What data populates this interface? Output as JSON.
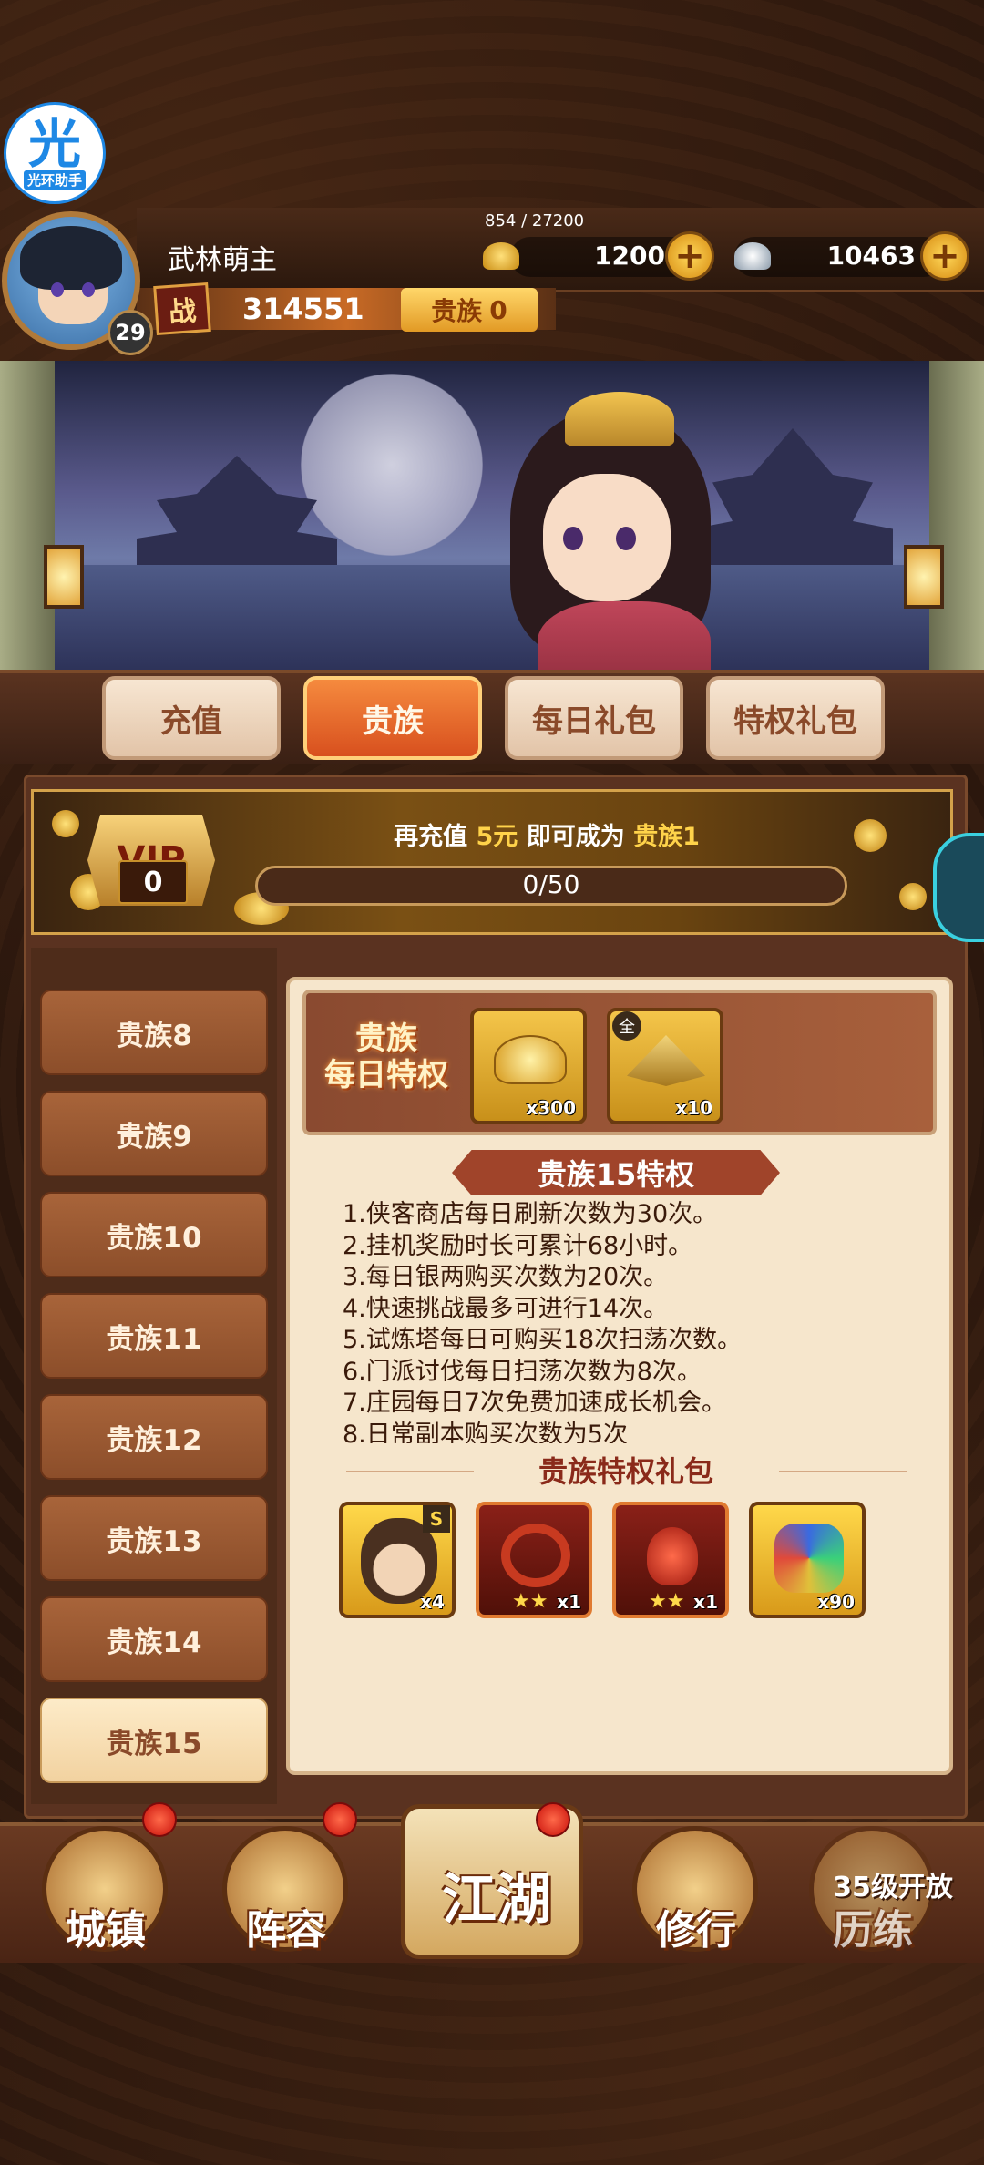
{
  "helper": {
    "glyph": "光",
    "label": "光环助手"
  },
  "player": {
    "name": "武林萌主",
    "level": "29",
    "exp_text": "854 / 27200",
    "power_label": "战",
    "power": "314551",
    "noble_label": "贵族",
    "noble_level": "0"
  },
  "currency": {
    "gold": "1200",
    "silver": "10463",
    "plus": "+"
  },
  "tabs": [
    {
      "label": "充值",
      "active": false
    },
    {
      "label": "贵族",
      "active": true
    },
    {
      "label": "每日礼包",
      "active": false
    },
    {
      "label": "特权礼包",
      "active": false
    }
  ],
  "vip": {
    "badge": "VIP",
    "level": "0",
    "msg_prefix": "再充值",
    "msg_amount": "5元",
    "msg_mid": "即可成为",
    "msg_target": "贵族1",
    "progress_text": "0/50",
    "progress_value": 0
  },
  "sidebar": {
    "items": [
      {
        "label": "贵族8",
        "active": false
      },
      {
        "label": "贵族9",
        "active": false
      },
      {
        "label": "贵族10",
        "active": false
      },
      {
        "label": "贵族11",
        "active": false
      },
      {
        "label": "贵族12",
        "active": false
      },
      {
        "label": "贵族13",
        "active": false
      },
      {
        "label": "贵族14",
        "active": false
      },
      {
        "label": "贵族15",
        "active": true
      }
    ]
  },
  "daily": {
    "title_line1": "贵族",
    "title_line2": "每日特权",
    "items": [
      {
        "icon": "gold-ingot-icon",
        "qty": "x300"
      },
      {
        "icon": "bamboo-hat-icon",
        "badge": "全",
        "qty": "x10"
      }
    ]
  },
  "privilege": {
    "title": "贵族15特权",
    "lines": [
      "1.侠客商店每日刷新次数为30次。",
      "2.挂机奖励时长可累计68小时。",
      "3.每日银两购买次数为20次。",
      "4.快速挑战最多可进行14次。",
      "5.试炼塔每日可购买18次扫荡次数。",
      "6.门派讨伐每日扫荡次数为8次。",
      "7.庄园每日7次免费加速成长机会。",
      "8.日常副本购买次数为5次"
    ]
  },
  "gift": {
    "title": "贵族特权礼包",
    "items": [
      {
        "icon": "hero-portrait-icon",
        "badge": "S",
        "qty": "x4"
      },
      {
        "icon": "red-ring-icon",
        "stars": "★★",
        "qty": "x1"
      },
      {
        "icon": "red-ornament-icon",
        "stars": "★★",
        "qty": "x1"
      },
      {
        "icon": "gem-cluster-icon",
        "qty": "x90"
      }
    ]
  },
  "nav": {
    "town": "城镇",
    "lineup": "阵容",
    "jianghu": "江湖",
    "cultivate": "修行",
    "trial": "历练",
    "trial_lock": "35级开放"
  },
  "colors": {
    "accent": "#d8501e",
    "gold": "#ffd34a",
    "panel": "#f6e6cc"
  }
}
